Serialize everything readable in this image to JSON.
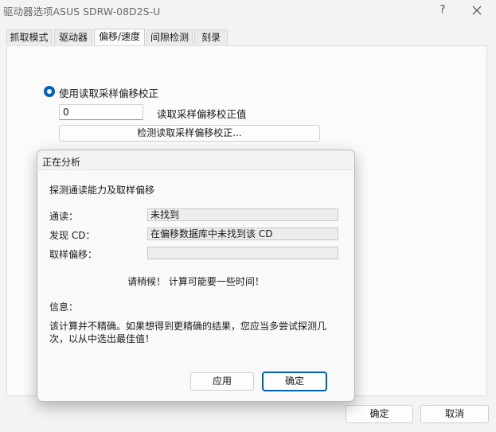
{
  "window": {
    "title": "驱动器选项ASUS    SDRW-08D2S-U",
    "help_label": "?",
    "close_icon": "close-icon"
  },
  "tabs": [
    {
      "label": "抓取模式",
      "active": false
    },
    {
      "label": "驱动器",
      "active": false
    },
    {
      "label": "偏移/速度",
      "active": true
    },
    {
      "label": "间隙检测",
      "active": false
    },
    {
      "label": "刻录",
      "active": false
    }
  ],
  "offset": {
    "radio_label": "使用读取采样偏移校正",
    "radio_checked": true,
    "value": "0",
    "value_label": "读取采样偏移校正值",
    "detect_button": "检测读取采样偏移校正..."
  },
  "footer": {
    "ok": "确定",
    "cancel": "取消"
  },
  "dialog": {
    "title": "正在分析",
    "heading": "探测通读能力及取样偏移",
    "rows": [
      {
        "label": "通读：",
        "value": "未找到"
      },
      {
        "label": "发现 CD：",
        "value": "在偏移数据库中未找到该 CD"
      },
      {
        "label": "取样偏移：",
        "value": ""
      }
    ],
    "wait_text": "请稍候！ 计算可能要一些时间！",
    "info_label": "信息：",
    "info_text": "该计算并不精确。如果想得到更精确的结果，您应当多尝试探测几次，以从中选出最佳值！",
    "apply_button": "应用",
    "ok_button": "确定"
  },
  "colors": {
    "accent": "#005fb8"
  }
}
